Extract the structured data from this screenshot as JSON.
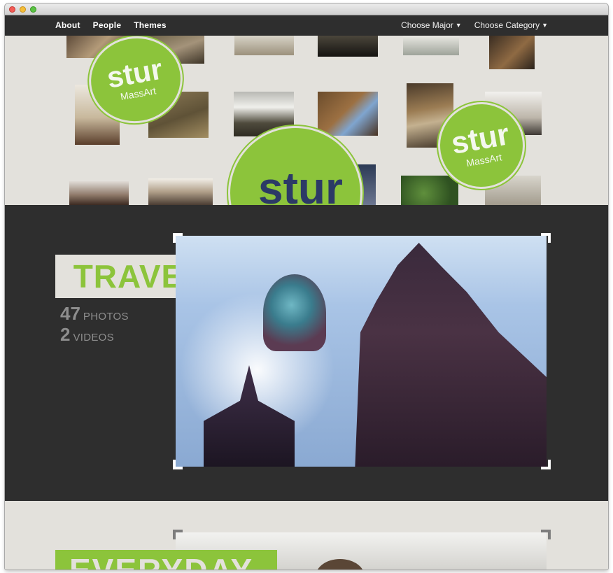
{
  "nav": {
    "links": [
      "About",
      "People",
      "Themes"
    ],
    "dropdowns": [
      {
        "label": "Choose Major",
        "icon": "caret-down-icon"
      },
      {
        "label": "Choose Category",
        "icon": "caret-down-icon"
      }
    ]
  },
  "hero": {
    "stamps": [
      {
        "word": "stur",
        "sub": "MassArt"
      },
      {
        "word": "stur",
        "sub": "MassArt"
      },
      {
        "word": "stur"
      }
    ]
  },
  "travel": {
    "title": "TRAVEL",
    "photos_count": "47",
    "photos_label": "PHOTOS",
    "videos_count": "2",
    "videos_label": "VIDEOS"
  },
  "everyday": {
    "title": "EVERYDAY"
  },
  "colors": {
    "accent_green": "#8cc43b",
    "dark_bg": "#2e2e2e",
    "light_bg": "#e3e1dc"
  }
}
